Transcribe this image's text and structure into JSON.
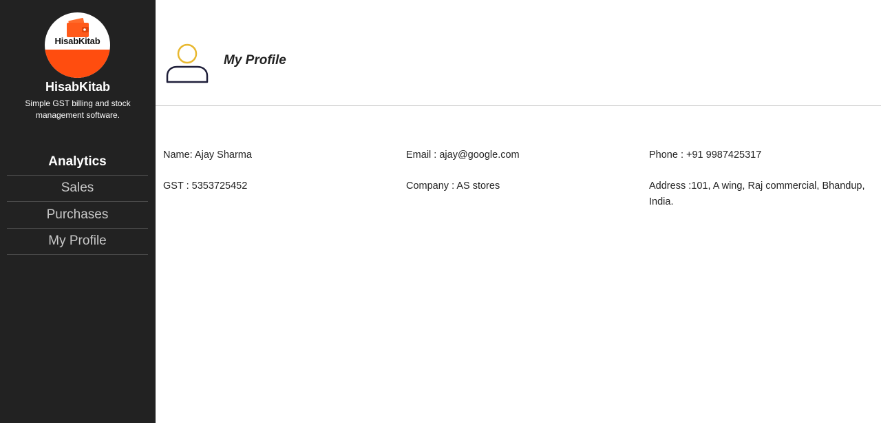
{
  "sidebar": {
    "logo_text": "HisabKitab",
    "brand_name": "HisabKitab",
    "tagline": "Simple GST billing and stock management software.",
    "items": [
      {
        "label": "Analytics",
        "active": true
      },
      {
        "label": "Sales",
        "active": false
      },
      {
        "label": "Purchases",
        "active": false
      },
      {
        "label": "My Profile",
        "active": false
      }
    ]
  },
  "header": {
    "icon": "user-icon",
    "title": "My Profile"
  },
  "profile": {
    "name": "Name: Ajay Sharma",
    "email": "Email : ajay@google.com",
    "phone": "Phone : +91 9987425317",
    "gst": "GST : 5353725452",
    "company": "Company : AS stores",
    "address": "Address :101, A wing, Raj commercial, Bhandup, India."
  },
  "colors": {
    "sidebar_bg": "#222222",
    "logo_accent": "#ff4d0f",
    "icon_head": "#e8b830",
    "icon_body": "#1f1f3a"
  }
}
